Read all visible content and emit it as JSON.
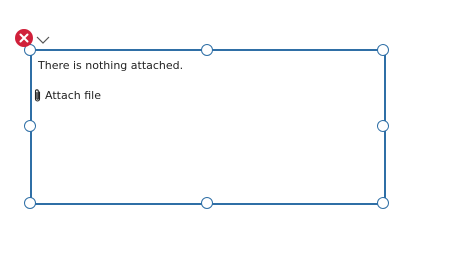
{
  "attachments_control": {
    "empty_message": "There is nothing attached.",
    "attach_label": "Attach file"
  },
  "toolbar": {
    "delete_icon": "close-icon",
    "expand_icon": "chevron-down-icon"
  },
  "colors": {
    "selection_border": "#2f6fa6",
    "delete_button": "#d0203a"
  }
}
